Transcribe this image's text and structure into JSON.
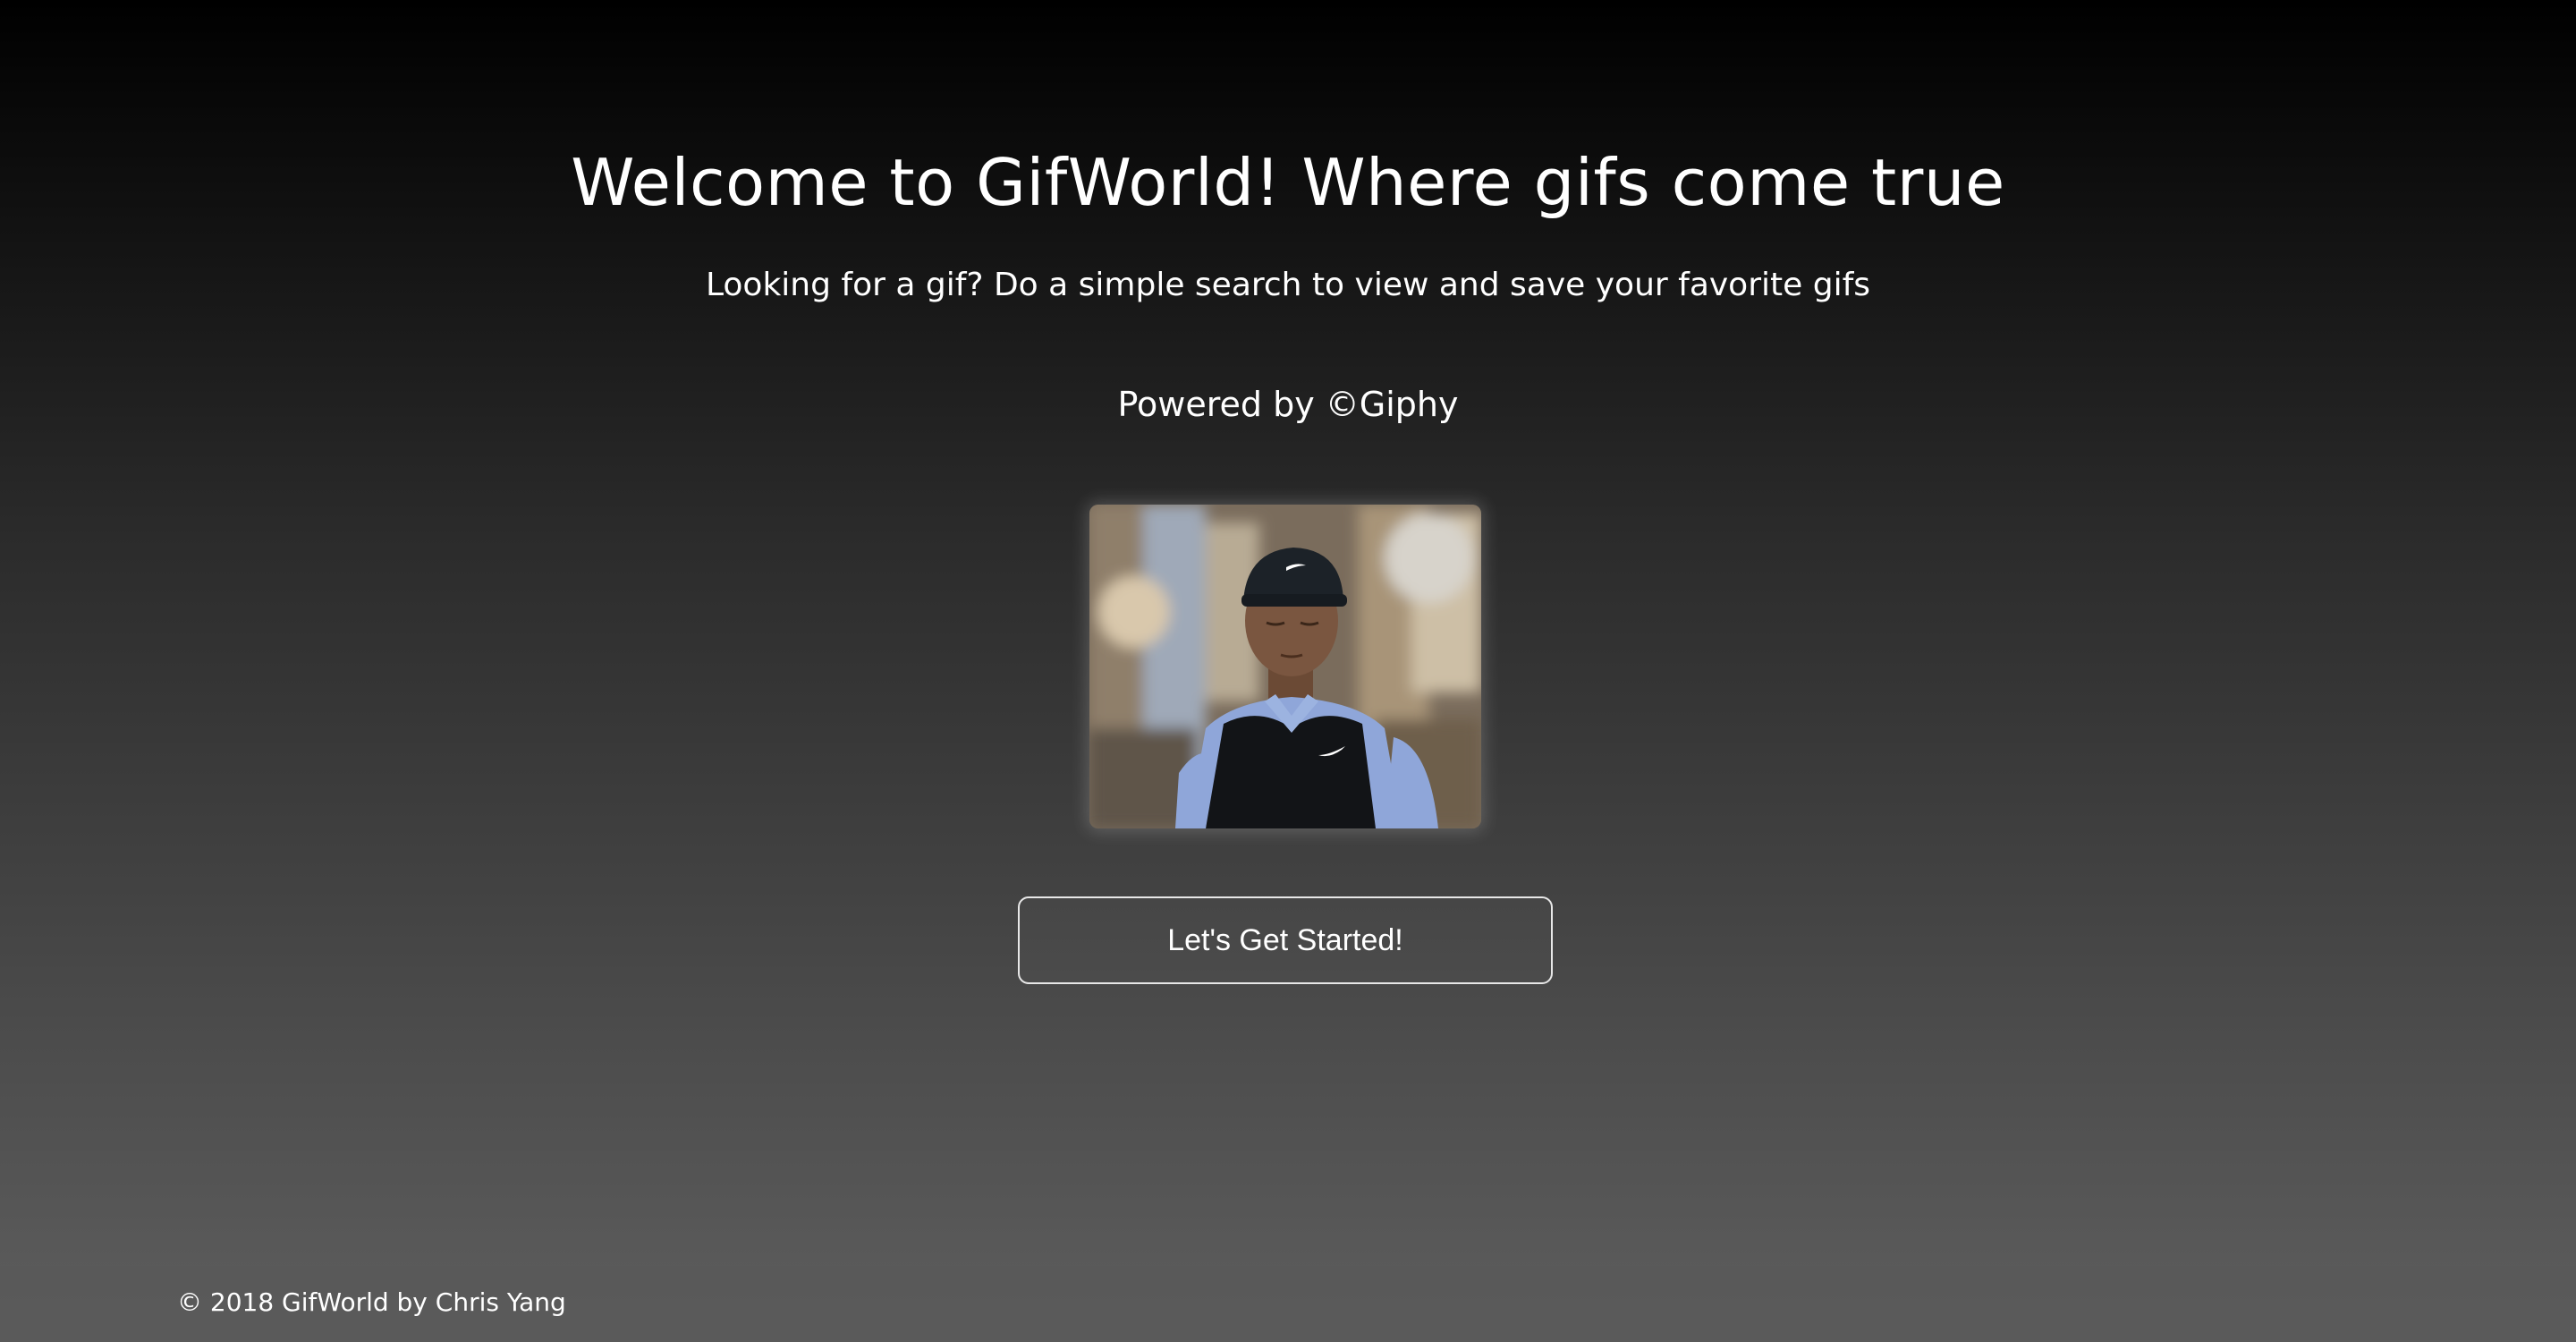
{
  "hero": {
    "title": "Welcome to GifWorld! Where gifs come true",
    "subtitle": "Looking for a gif? Do a simple search to view and save your favorite gifs",
    "powered_by": "Powered by ©Giphy"
  },
  "gif": {
    "icon": "animated-gif-image"
  },
  "cta": {
    "label": "Let's Get Started!"
  },
  "footer": {
    "copyright": "© 2018 GifWorld by Chris Yang"
  },
  "colors": {
    "background_top": "#000000",
    "background_bottom": "#5e5e5e",
    "text": "#ffffff",
    "button_border": "#e8e8e8"
  }
}
